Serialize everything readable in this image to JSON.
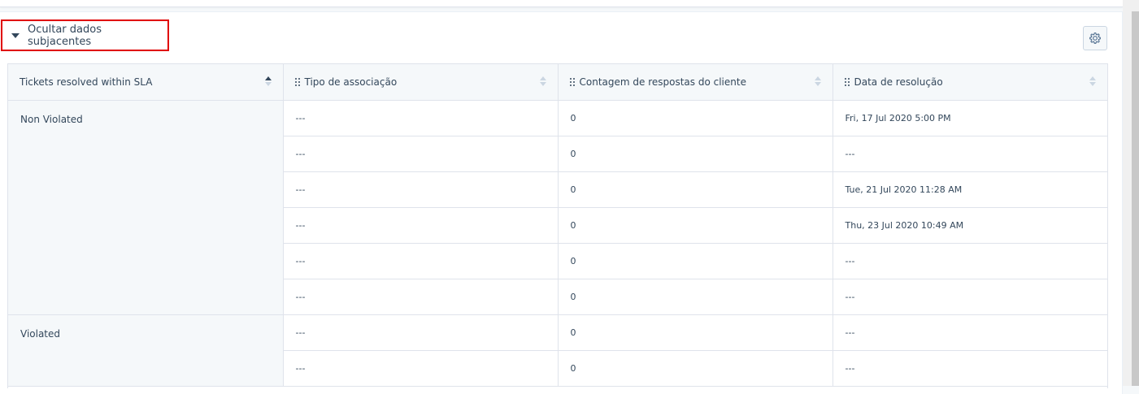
{
  "toggle": {
    "label": "Ocultar dados subjacentes"
  },
  "settings": {
    "icon": "gear-icon"
  },
  "table": {
    "headers": [
      "Tickets resolved within SLA",
      "Tipo de associação",
      "Contagem de respostas do cliente",
      "Data de resolução"
    ],
    "groups": [
      {
        "label": "Non Violated",
        "rows": [
          [
            "---",
            "0",
            "Fri, 17 Jul 2020 5:00 PM"
          ],
          [
            "---",
            "0",
            "---"
          ],
          [
            "---",
            "0",
            "Tue, 21 Jul 2020 11:28 AM"
          ],
          [
            "---",
            "0",
            "Thu, 23 Jul 2020 10:49 AM"
          ],
          [
            "---",
            "0",
            "---"
          ],
          [
            "---",
            "0",
            "---"
          ]
        ]
      },
      {
        "label": "Violated",
        "rows": [
          [
            "---",
            "0",
            "---"
          ],
          [
            "---",
            "0",
            "---"
          ]
        ]
      }
    ]
  },
  "colors": {
    "highlight": "#e00000",
    "header_bg": "#f5f8fa",
    "border": "#dfe3eb",
    "text": "#33475b"
  }
}
